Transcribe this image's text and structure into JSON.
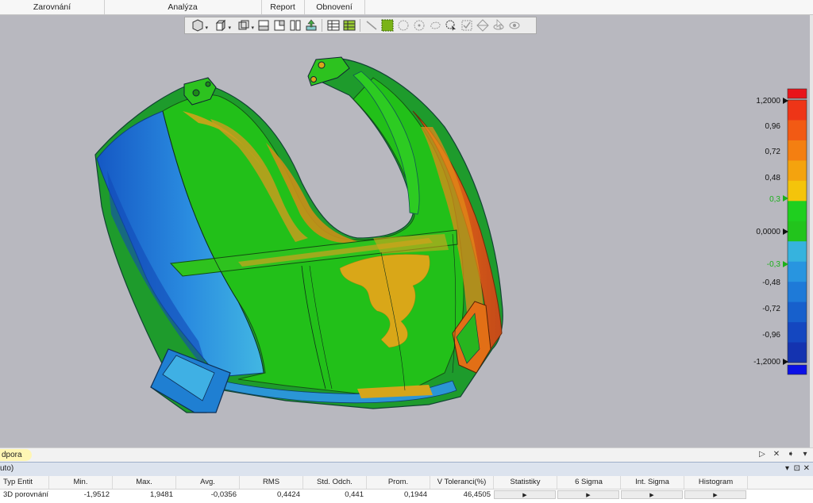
{
  "ribbon": {
    "groups": [
      "Zarovnání",
      "Analýza",
      "Report",
      "Obnovení"
    ]
  },
  "toolbar": {
    "icons": [
      "view-cube-icon",
      "box-view-icon",
      "section-view-icon",
      "layout-1-icon",
      "layout-2-icon",
      "layout-3-icon",
      "export-icon",
      "grid-icon",
      "grid-highlight-icon",
      "line-tool-icon",
      "select-area-icon",
      "circle-select-icon",
      "target-icon",
      "lasso-icon",
      "pick-icon",
      "check-icon",
      "diamond-icon",
      "pointer-icon",
      "eye-icon"
    ]
  },
  "legend": {
    "labels": [
      "1,2000",
      "0,96",
      "0,72",
      "0,48",
      "0,3",
      "0,0000",
      "-0,3",
      "-0,48",
      "-0,72",
      "-0,96",
      "-1,2000"
    ],
    "colors": [
      "#e8141a",
      "#ee3517",
      "#f25a14",
      "#f47f11",
      "#f4a30e",
      "#f4c40b",
      "#1fcf1f",
      "#22c41c",
      "#36b3de",
      "#2895e0",
      "#1e7ad8",
      "#1760cc",
      "#1447c0",
      "#1433b0",
      "#0b10e6"
    ]
  },
  "panel": {
    "tab_label": "dpora",
    "header_text": "uto)",
    "columns": [
      "Typ Entit",
      "Min.",
      "Max.",
      "Avg.",
      "RMS",
      "Std. Odch.",
      "Prom.",
      "V Toleranci(%)",
      "Statistiky",
      "6 Sigma",
      "Int. Sigma",
      "Histogram"
    ],
    "row": {
      "type": "3D porovnání",
      "min": "-1,9512",
      "max": "1,9481",
      "avg": "-0,0356",
      "rms": "0,4424",
      "std": "0,441",
      "var": "0,1944",
      "tol": "46,4505"
    }
  }
}
